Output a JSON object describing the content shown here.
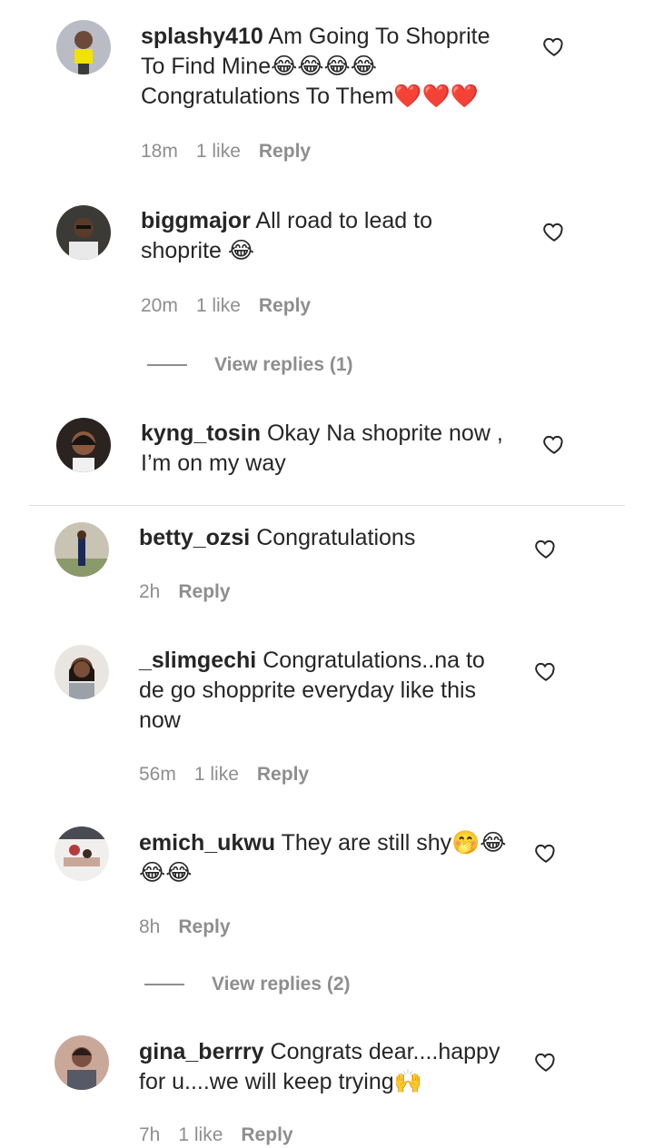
{
  "comments": [
    {
      "username": "splashy410",
      "text": "Am Going To Shoprite To Find Mine😂😂😂😂 Congratulations To Them❤️❤️❤️",
      "time": "18m",
      "likes": "1 like",
      "reply": "Reply"
    },
    {
      "username": "biggmajor",
      "text": "All road to lead to shoprite 😂",
      "time": "20m",
      "likes": "1 like",
      "reply": "Reply"
    },
    {
      "username": "kyng_tosin",
      "text": "Okay Na shoprite now , I’m on my way"
    },
    {
      "username": "betty_ozsi",
      "text": "Congratulations",
      "time": "2h",
      "reply": "Reply"
    },
    {
      "username": "_slimgechi",
      "text": "Congratulations..na to de go shopprite everyday like this now",
      "time": "56m",
      "likes": "1 like",
      "reply": "Reply"
    },
    {
      "username": "emich_ukwu",
      "text": "They are still shy🤭😂😂😂",
      "time": "8h",
      "reply": "Reply"
    },
    {
      "username": "gina_berrry",
      "text": "Congrats dear....happy for u....we will keep trying🙌",
      "time": "7h",
      "likes": "1 like",
      "reply": "Reply"
    }
  ],
  "view_replies": [
    {
      "label": "View replies (1)"
    },
    {
      "label": "View replies (2)"
    }
  ],
  "icons": {
    "like": "heart-outline-icon",
    "avatar": "user-avatar"
  },
  "colors": {
    "text": "#262626",
    "meta": "#8e8e8e",
    "divider": "#dbdbdb"
  }
}
